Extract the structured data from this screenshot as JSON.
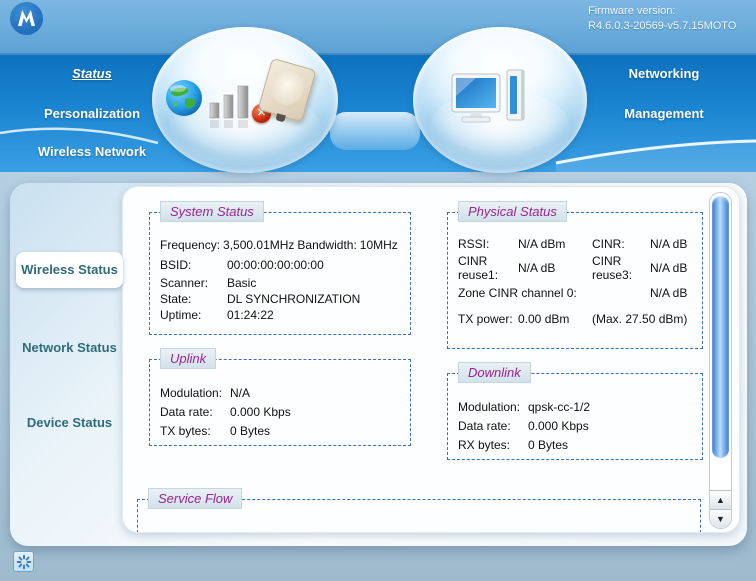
{
  "header": {
    "firmware_label": "Firmware version:",
    "firmware_version": "R4.6.0.3-20569-v5.7.15MOTO"
  },
  "nav_left": [
    {
      "label": "Status",
      "active": true
    },
    {
      "label": "Personalization",
      "active": false
    },
    {
      "label": "Wireless Network",
      "active": false
    }
  ],
  "nav_right": [
    {
      "label": "Networking"
    },
    {
      "label": "Management"
    }
  ],
  "sidebar": {
    "tabs": [
      {
        "label": "Wireless Status",
        "active": true
      },
      {
        "label": "Network Status",
        "active": false
      },
      {
        "label": "Device Status",
        "active": false
      }
    ]
  },
  "system_status": {
    "title": "System Status",
    "frequency_label": "Frequency:",
    "frequency_value": "3,500.01MHz",
    "bandwidth_label": "Bandwidth:",
    "bandwidth_value": "10MHz",
    "rows": [
      {
        "label": "BSID:",
        "value": "00:00:00:00:00:00"
      },
      {
        "label": "Scanner:",
        "value": "Basic"
      },
      {
        "label": "State:",
        "value": "DL SYNCHRONIZATION"
      },
      {
        "label": "Uptime:",
        "value": "01:24:22"
      }
    ]
  },
  "physical_status": {
    "title": "Physical Status",
    "rows": [
      {
        "l1": "RSSI:",
        "v1": "N/A dBm",
        "l2": "CINR:",
        "v2": "N/A dB"
      },
      {
        "l1": "CINR reuse1:",
        "v1": "N/A dB",
        "l2": "CINR reuse3:",
        "v2": "N/A dB"
      }
    ],
    "zone_label": "Zone CINR channel 0:",
    "zone_value": "N/A dB",
    "tx_label": "TX power:",
    "tx_value": "0.00 dBm",
    "tx_max": "(Max. 27.50 dBm)"
  },
  "uplink": {
    "title": "Uplink",
    "rows": [
      {
        "label": "Modulation:",
        "value": "N/A"
      },
      {
        "label": "Data rate:",
        "value": "0.000 Kbps"
      },
      {
        "label": "TX bytes:",
        "value": "0 Bytes"
      }
    ]
  },
  "downlink": {
    "title": "Downlink",
    "rows": [
      {
        "label": "Modulation:",
        "value": "qpsk-cc-1/2"
      },
      {
        "label": "Data rate:",
        "value": "0.000 Kbps"
      },
      {
        "label": "RX bytes:",
        "value": "0 Bytes"
      }
    ]
  },
  "service_flow": {
    "title": "Service Flow"
  },
  "icons": {
    "disconnected_glyph": "✕",
    "scroll_up": "▲",
    "scroll_down": "▼"
  },
  "colors": {
    "topbar_blue": "#66a9d9",
    "navband_top": "#0d72bf",
    "navband_bottom": "#3aa0e4",
    "legend_text": "#9a2492",
    "dashed_border": "#3c6fb8",
    "sidebar_text": "#2f6b7a",
    "scroll_thumb": "#6ba6e8",
    "disconnected_red": "#cc2605"
  }
}
